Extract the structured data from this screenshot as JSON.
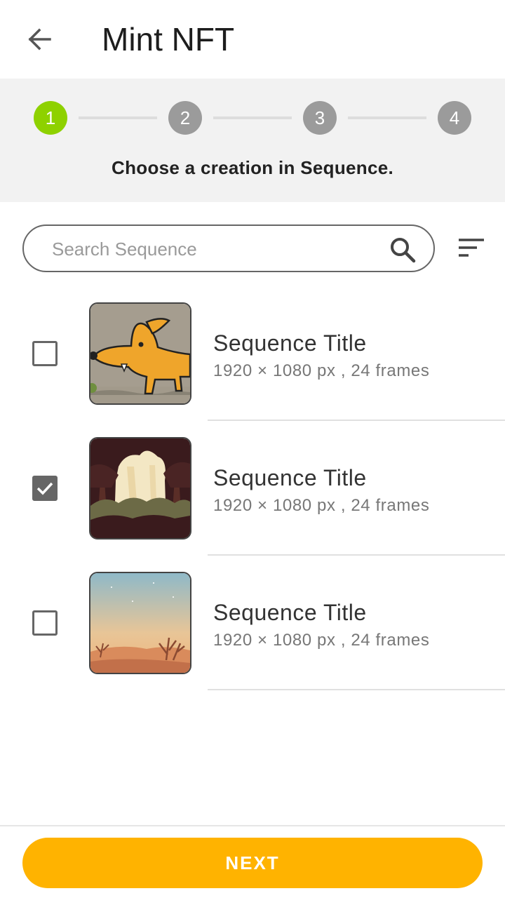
{
  "header": {
    "title": "Mint NFT",
    "back_icon": "arrow-left-icon"
  },
  "stepper": {
    "steps": [
      "1",
      "2",
      "3",
      "4"
    ],
    "active_step": 1,
    "caption": "Choose a creation in Sequence.",
    "active_color": "#8ed100",
    "inactive_color": "#9b9b9b"
  },
  "search": {
    "placeholder": "Search Sequence",
    "value": ""
  },
  "sequences": [
    {
      "title": "Sequence Title",
      "meta": "1920 × 1080 px , 24 frames",
      "checked": false,
      "thumbnail": "cartoon-dog-thumbnail"
    },
    {
      "title": "Sequence Title",
      "meta": "1920 × 1080 px , 24 frames",
      "checked": true,
      "thumbnail": "forest-thumbnail"
    },
    {
      "title": "Sequence Title",
      "meta": "1920 × 1080 px , 24 frames",
      "checked": false,
      "thumbnail": "desert-thumbnail"
    }
  ],
  "next_button": {
    "label": "NEXT",
    "color": "#ffb300"
  }
}
